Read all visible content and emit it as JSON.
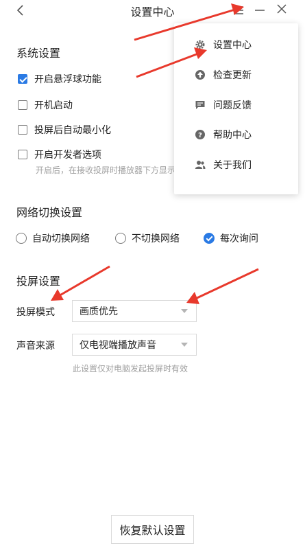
{
  "window": {
    "title": "设置中心",
    "back_icon": "chevron-left-icon",
    "menu_icon": "hamburger-icon",
    "minimize_icon": "minimize-icon",
    "close_icon": "close-icon"
  },
  "system": {
    "title": "系统设置",
    "options": [
      {
        "label": "开启悬浮球功能",
        "checked": true
      },
      {
        "label": "开机启动",
        "checked": false
      },
      {
        "label": "投屏后自动最小化",
        "checked": false
      },
      {
        "label": "开启开发者选项",
        "checked": false
      }
    ],
    "dev_hint": "开启后，在接收投屏时播放器下方显示"
  },
  "network": {
    "title": "网络切换设置",
    "options": [
      {
        "label": "自动切换网络",
        "checked": false
      },
      {
        "label": "不切换网络",
        "checked": false
      },
      {
        "label": "每次询问",
        "checked": true
      }
    ]
  },
  "cast": {
    "title": "投屏设置",
    "mode_label": "投屏模式",
    "mode_value": "画质优先",
    "audio_label": "声音来源",
    "audio_value": "仅电视端播放声音",
    "audio_hint": "此设置仅对电脑发起投屏时有效"
  },
  "menu": {
    "items": [
      {
        "label": "设置中心",
        "icon": "gear-icon"
      },
      {
        "label": "检查更新",
        "icon": "arrow-up-circle-icon"
      },
      {
        "label": "问题反馈",
        "icon": "chat-icon"
      },
      {
        "label": "帮助中心",
        "icon": "question-circle-icon"
      },
      {
        "label": "关于我们",
        "icon": "users-icon"
      }
    ]
  },
  "footer": {
    "reset_label": "恢复默认设置"
  },
  "colors": {
    "accent": "#2a7ae4",
    "annotation_arrow": "#e8392c"
  }
}
